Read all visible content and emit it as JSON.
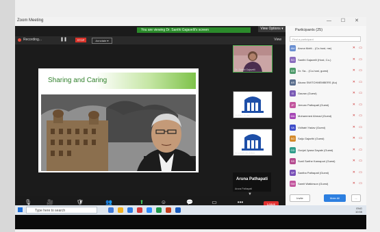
{
  "window": {
    "title": "Zoom Meeting",
    "controls": "— ☐ ✕"
  },
  "share_banner": "You are viewing Dr. Santhi Gajavelli's screen",
  "view_options": "View Options ▾",
  "recording": {
    "label": "Recording...",
    "pause": "❚❚",
    "stop": "STOP",
    "annotate": "Annotate ▾",
    "view": "View"
  },
  "slide": {
    "title": "Sharing and Caring"
  },
  "thumbnails": [
    {
      "caption": "Dr. Santhi Gajavelli"
    },
    {
      "caption": "CLERC PUNE"
    },
    {
      "caption": "SCLEMS MUMBAI"
    }
  ],
  "speaker": {
    "name": "Aruna Pathapati",
    "sub": "Aruna Pathapati"
  },
  "toolbar": [
    {
      "icon": "🎙",
      "label": "Unmute"
    },
    {
      "icon": "🎥",
      "label": "Start Video"
    },
    {
      "icon": "🛡",
      "label": "Security"
    },
    {
      "icon": "👥",
      "label": "Participants"
    },
    {
      "icon": "⬆",
      "label": "Share Screen"
    },
    {
      "icon": "☺",
      "label": "Reactions"
    },
    {
      "icon": "💬",
      "label": "Chat"
    },
    {
      "icon": "▭",
      "label": "Whiteboards"
    },
    {
      "icon": "•••",
      "label": "More"
    }
  ],
  "end_label": "Leave",
  "participants": {
    "title": "Participants (25)",
    "search_placeholder": "Find a participant",
    "list": [
      {
        "initials": "AM",
        "color": "#6a8fd1",
        "name": "Aruna Motti... (Co-host, me)"
      },
      {
        "initials": "SG",
        "color": "#8a6bbd",
        "name": "Santhi Gajavelli (Host, Co-)"
      },
      {
        "initials": "DS",
        "color": "#4e9a6a",
        "name": "Dr. Sa... (Co-host, guest)"
      },
      {
        "initials": "AS",
        "color": "#5a6e8c",
        "name": "Akuna SWITCHMEMBERS (Au)"
      },
      {
        "initials": "G",
        "color": "#7b5bb5",
        "name": "Gaurav (Guest)"
      },
      {
        "initials": "JP",
        "color": "#c2559d",
        "name": "Jeevan Pathapati (Guest)"
      },
      {
        "initials": "MA",
        "color": "#a646b5",
        "name": "Mohammed Ahmad (Guest)"
      },
      {
        "initials": "VA",
        "color": "#3f4ec9",
        "name": "Vidhatri Yadav (Guest)"
      },
      {
        "initials": "SG",
        "color": "#d48a2b",
        "name": "Saiju Gajarthi (Guest)"
      },
      {
        "initials": "GD",
        "color": "#2f9c8a",
        "name": "Gunjal Jyana Dayale (Guest)"
      },
      {
        "initials": "SS",
        "color": "#b44a8e",
        "name": "Sunil Sarthe Kamapuri (Guest)"
      },
      {
        "initials": "SP",
        "color": "#7a52b8",
        "name": "Santha Pathapati (Guest)"
      },
      {
        "initials": "SW",
        "color": "#c2559d",
        "name": "Samit Watkinson (Guest)"
      }
    ],
    "invite": "Invite",
    "mute_all": "Mute All",
    "more": "..."
  },
  "taskbar": {
    "search": "Type here to search",
    "time": "10:55",
    "date": "21-11-2022",
    "lang": "ENG"
  }
}
